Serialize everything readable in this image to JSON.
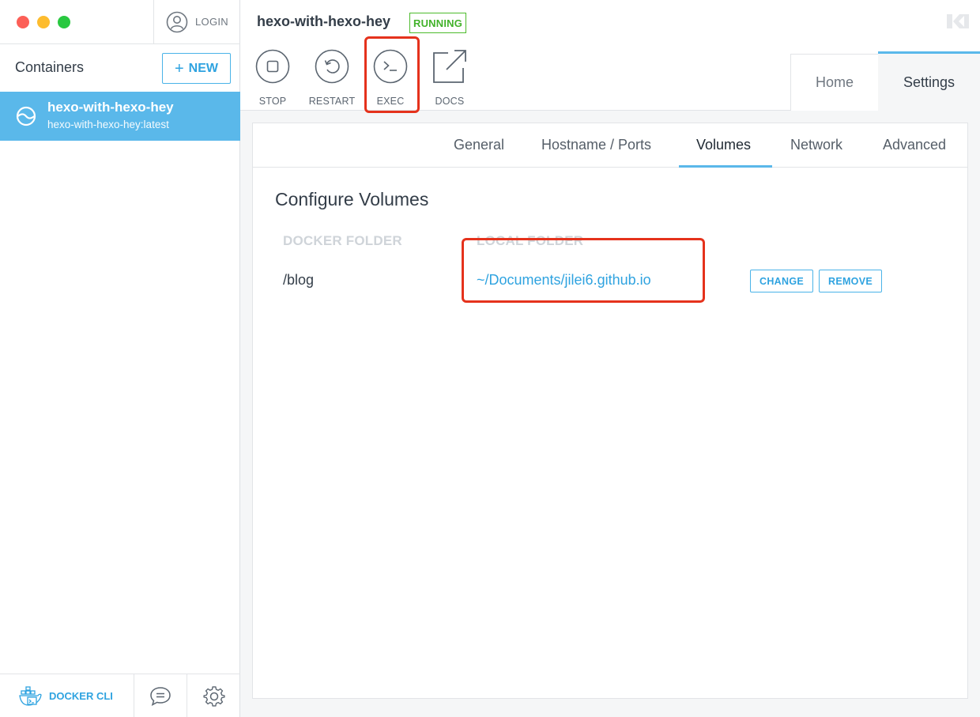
{
  "sidebar": {
    "login_label": "LOGIN",
    "containers_title": "Containers",
    "new_button": {
      "icon": "plus",
      "label": "NEW"
    },
    "containers": [
      {
        "name": "hexo-with-hexo-hey",
        "image": "hexo-with-hexo-hey:latest",
        "selected": true
      }
    ],
    "bottom": {
      "docker_cli_label": "DOCKER CLI"
    }
  },
  "header": {
    "container_name": "hexo-with-hexo-hey",
    "status": "RUNNING",
    "actions": [
      {
        "label": "STOP",
        "icon": "stop-icon"
      },
      {
        "label": "RESTART",
        "icon": "restart-icon"
      },
      {
        "label": "EXEC",
        "icon": "terminal-icon",
        "highlighted": true
      },
      {
        "label": "DOCS",
        "icon": "external-link-icon"
      }
    ],
    "tabs": [
      {
        "label": "Home",
        "active": false
      },
      {
        "label": "Settings",
        "active": true
      }
    ]
  },
  "settings": {
    "subtabs": [
      {
        "label": "General",
        "active": false
      },
      {
        "label": "Hostname / Ports",
        "active": false
      },
      {
        "label": "Volumes",
        "active": true
      },
      {
        "label": "Network",
        "active": false
      },
      {
        "label": "Advanced",
        "active": false
      }
    ],
    "volumes": {
      "title": "Configure Volumes",
      "col_docker": "DOCKER FOLDER",
      "col_local": "LOCAL FOLDER",
      "rows": [
        {
          "docker": "/blog",
          "local": "~/Documents/jilei6.github.io",
          "change_label": "CHANGE",
          "remove_label": "REMOVE"
        }
      ]
    }
  },
  "colors": {
    "accent": "#5ab8ea",
    "link": "#2fa3e0",
    "running": "#42b22a",
    "highlight": "#e5321c"
  }
}
